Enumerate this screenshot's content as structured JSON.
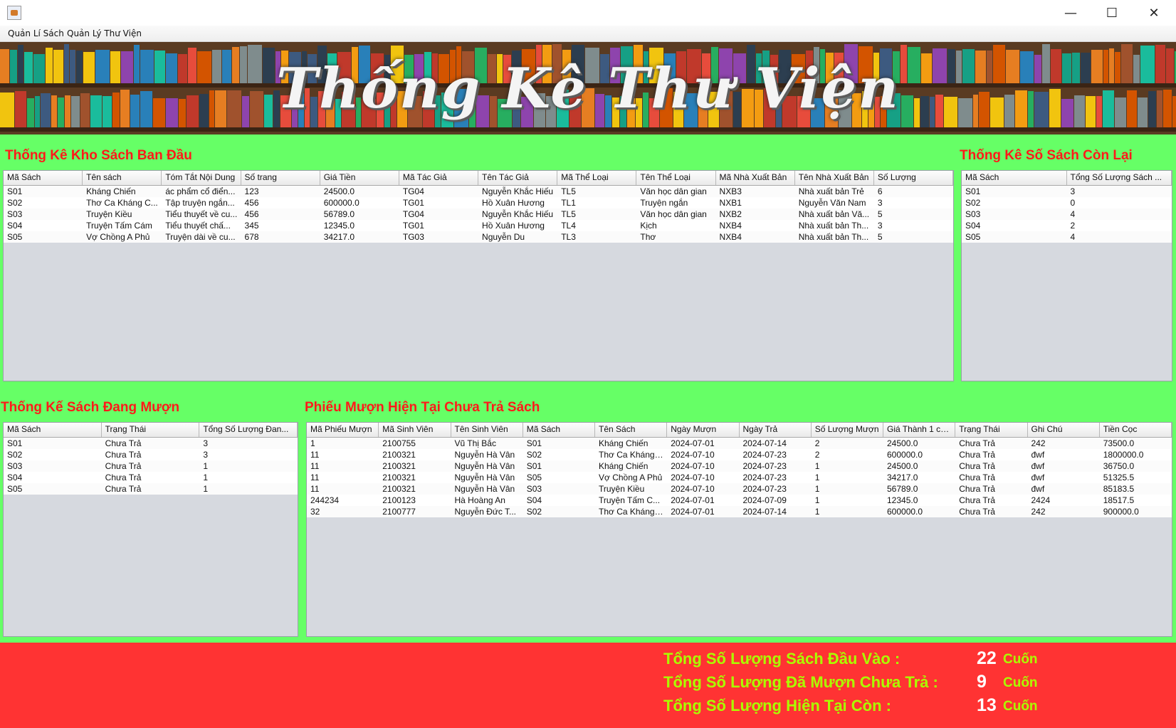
{
  "window": {
    "minimize": "—",
    "maximize": "☐",
    "close": "✕"
  },
  "menu": [
    "Quản Lí Sách",
    "Quản Lý Thư Viện"
  ],
  "banner": {
    "title": "Thống Kê Thư Viện"
  },
  "inventory": {
    "title": "Thống Kê Kho Sách Ban Đầu",
    "columns": [
      "Mã Sách",
      "Tên sách",
      "Tóm Tắt Nội Dung",
      "Số trang",
      "Giá Tiền",
      "Mã Tác Giả",
      "Tên Tác Giả",
      "Mã Thể Loại",
      "Tên Thể Loại",
      "Mã Nhà Xuất Bản",
      "Tên Nhà Xuất Bản",
      "Số Lượng"
    ],
    "rows": [
      [
        "S01",
        "Kháng Chiến",
        "ác phẩm cổ điển...",
        "123",
        "24500.0",
        "TG04",
        "Nguyễn Khắc Hiếu",
        "TL5",
        "Văn học dân gian",
        "NXB3",
        "Nhà xuất bản Trẻ",
        "6"
      ],
      [
        "S02",
        "Thơ Ca Kháng C...",
        "Tập truyện ngắn...",
        "456",
        "600000.0",
        "TG01",
        "Hồ Xuân Hương",
        "TL1",
        "Truyện ngắn",
        "NXB1",
        "Nguyễn Văn Nam",
        "3"
      ],
      [
        "S03",
        "Truyện Kiều",
        "Tiểu thuyết về cu...",
        "456",
        "56789.0",
        "TG04",
        "Nguyễn Khắc Hiếu",
        "TL5",
        "Văn học dân gian",
        "NXB2",
        "Nhà xuất bản Vă...",
        "5"
      ],
      [
        "S04",
        "Truyện Tấm Cám",
        "Tiểu thuyết chấ...",
        "345",
        "12345.0",
        "TG01",
        "Hồ Xuân Hương",
        "TL4",
        "Kịch",
        "NXB4",
        "Nhà xuất bản Th...",
        "3"
      ],
      [
        "S05",
        "Vợ Chồng A Phủ",
        "Truyện dài về cu...",
        "678",
        "34217.0",
        "TG03",
        "Nguyễn Du",
        "TL3",
        "Thơ",
        "NXB4",
        "Nhà xuất bản Th...",
        "5"
      ]
    ]
  },
  "remaining": {
    "title": "Thống Kê Số Sách Còn Lại",
    "columns": [
      "Mã Sách",
      "Tổng Số Lượng Sách ..."
    ],
    "rows": [
      [
        "S01",
        "3"
      ],
      [
        "S02",
        "0"
      ],
      [
        "S03",
        "4"
      ],
      [
        "S04",
        "2"
      ],
      [
        "S05",
        "4"
      ]
    ]
  },
  "borrowed": {
    "title": "Thống Kế Sách Đang Mượn",
    "columns": [
      "Mã Sách",
      "Trạng Thái",
      "Tổng Số Lượng Đan..."
    ],
    "rows": [
      [
        "S01",
        "Chưa Trả",
        "3"
      ],
      [
        "S02",
        "Chưa Trả",
        "3"
      ],
      [
        "S03",
        "Chưa Trả",
        "1"
      ],
      [
        "S04",
        "Chưa Trả",
        "1"
      ],
      [
        "S05",
        "Chưa Trả",
        "1"
      ]
    ]
  },
  "slips": {
    "title": "Phiếu Mượn Hiện Tại Chưa Trả Sách",
    "columns": [
      "Mã Phiếu Mượn",
      "Mã Sinh Viên",
      "Tên Sinh Viên",
      "Mã Sách",
      "Tên Sách",
      "Ngày Mượn",
      "Ngày Trả",
      "Số Lượng Mượn",
      "Giá Thành 1 cu...",
      "Trạng Thái",
      "Ghi Chú",
      "Tiền Cọc"
    ],
    "rows": [
      [
        "1",
        "2100755",
        "Vũ Thị Bắc",
        "S01",
        "Kháng Chiến",
        "2024-07-01",
        "2024-07-14",
        "2",
        "24500.0",
        "Chưa Trả",
        "242",
        "73500.0"
      ],
      [
        "11",
        "2100321",
        "Nguyễn Hà Vân",
        "S02",
        "Thơ Ca Kháng ...",
        "2024-07-10",
        "2024-07-23",
        "2",
        "600000.0",
        "Chưa Trả",
        "đwf",
        "1800000.0"
      ],
      [
        "11",
        "2100321",
        "Nguyễn Hà Vân",
        "S01",
        "Kháng Chiến",
        "2024-07-10",
        "2024-07-23",
        "1",
        "24500.0",
        "Chưa Trả",
        "đwf",
        "36750.0"
      ],
      [
        "11",
        "2100321",
        "Nguyễn Hà Vân",
        "S05",
        "Vợ Chồng A Phủ",
        "2024-07-10",
        "2024-07-23",
        "1",
        "34217.0",
        "Chưa Trả",
        "đwf",
        "51325.5"
      ],
      [
        "11",
        "2100321",
        "Nguyễn Hà Vân",
        "S03",
        "Truyện Kiều",
        "2024-07-10",
        "2024-07-23",
        "1",
        "56789.0",
        "Chưa Trả",
        "đwf",
        "85183.5"
      ],
      [
        "244234",
        "2100123",
        "Hà Hoàng An",
        "S04",
        "Truyện Tấm C...",
        "2024-07-01",
        "2024-07-09",
        "1",
        "12345.0",
        "Chưa Trả",
        "2424",
        "18517.5"
      ],
      [
        "32",
        "2100777",
        "Nguyễn Đức T...",
        "S02",
        "Thơ Ca Kháng ...",
        "2024-07-01",
        "2024-07-14",
        "1",
        "600000.0",
        "Chưa Trả",
        "242",
        "900000.0"
      ]
    ]
  },
  "summary": {
    "input_label": "Tổng Số Lượng Sách Đầu Vào :",
    "input_value": "22",
    "borrowed_label": "Tổng Số Lượng Đã Mượn Chưa Trả :",
    "borrowed_value": "9",
    "current_label": "Tổng Số Lượng Hiện  Tại Còn :",
    "current_value": "13",
    "unit": "Cuốn"
  }
}
